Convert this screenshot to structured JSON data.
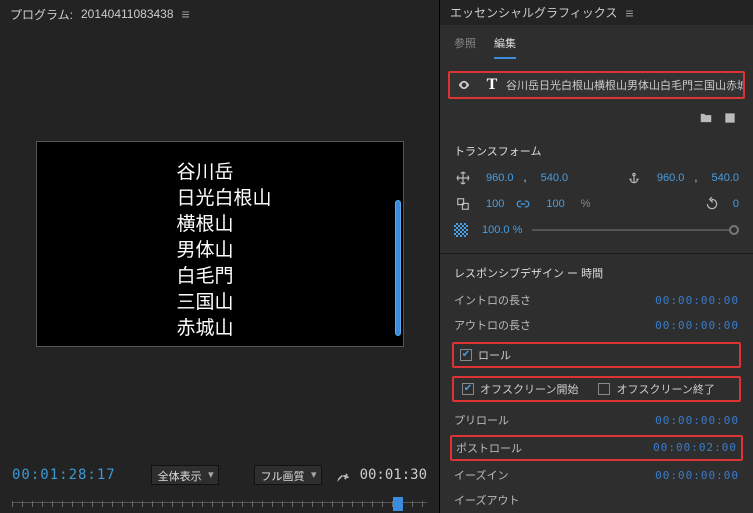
{
  "program": {
    "label": "プログラム:",
    "name": "20140411083438"
  },
  "credits": [
    "谷川岳",
    "日光白根山",
    "横根山",
    "男体山",
    "白毛門",
    "三国山",
    "赤城山"
  ],
  "controls": {
    "tc_left": "00:01:28:17",
    "view_mode": "全体表示",
    "quality": "フル画質",
    "tc_right": "00:01:30"
  },
  "panel_title": "エッセンシャルグラフィックス",
  "tabs": {
    "browse": "参照",
    "edit": "編集"
  },
  "layer_name": "谷川岳日光白根山横根山男体山白毛門三国山赤城山",
  "transform": {
    "title": "トランスフォーム",
    "pos_x": "960.0",
    "pos_y": "540.0",
    "anchor_x": "960.0",
    "anchor_y": "540.0",
    "scale_w": "100",
    "scale_h": "100",
    "pct": "%",
    "rotation": "0",
    "opacity": "100.0 %"
  },
  "responsive": {
    "title": "レスポンシブデザイン ー 時間",
    "intro_label": "イントロの長さ",
    "intro_tc": "00:00:00:00",
    "outro_label": "アウトロの長さ",
    "outro_tc": "00:00:00:00",
    "roll_label": "ロール",
    "offscreen_start": "オフスクリーン開始",
    "offscreen_end": "オフスクリーン終了",
    "preroll_label": "プリロール",
    "preroll_tc": "00:00:00:00",
    "postroll_label": "ポストロール",
    "postroll_tc": "00:00:02:00",
    "easein_label": "イーズイン",
    "easein_tc": "00:00:00:00",
    "easeout_label": "イーズアウト"
  }
}
